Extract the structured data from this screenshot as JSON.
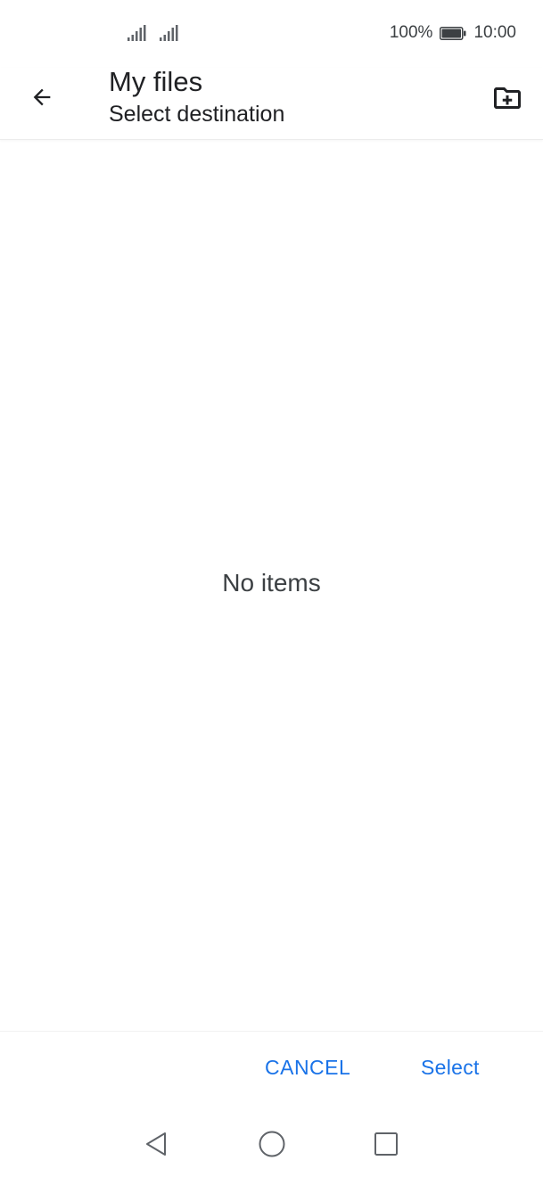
{
  "status_bar": {
    "battery_percent": "100%",
    "time": "10:00",
    "icons": [
      "signal-icon",
      "signal-icon",
      "battery-icon"
    ]
  },
  "app_bar": {
    "title": "My files",
    "subtitle": "Select destination",
    "back_icon": "arrow-left-icon",
    "new_folder_icon": "new-folder-icon"
  },
  "content": {
    "empty_message": "No items"
  },
  "actions": {
    "cancel_label": "CANCEL",
    "select_label": "Select",
    "accent_color": "#1a73e8"
  },
  "nav_bar": {
    "icons": [
      "triangle-back-icon",
      "circle-home-icon",
      "square-recents-icon"
    ]
  }
}
